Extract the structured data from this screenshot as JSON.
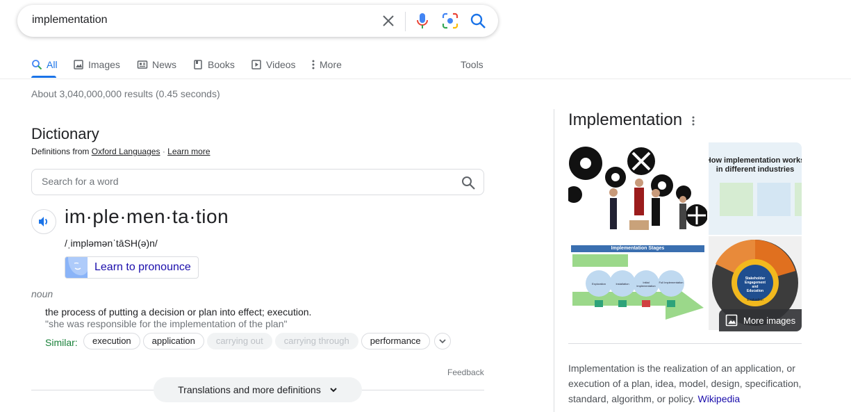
{
  "search": {
    "query": "implementation"
  },
  "tabs": [
    {
      "label": "All"
    },
    {
      "label": "Images"
    },
    {
      "label": "News"
    },
    {
      "label": "Books"
    },
    {
      "label": "Videos"
    },
    {
      "label": "More"
    }
  ],
  "tools_label": "Tools",
  "stats": "About 3,040,000,000 results (0.45 seconds)",
  "dictionary": {
    "title": "Dictionary",
    "source_prefix": "Definitions from",
    "source_name": "Oxford Languages",
    "separator": "·",
    "learn_more": "Learn more",
    "word_search_placeholder": "Search for a word",
    "headword": "im·ple·men·ta·tion",
    "phonetic": "/ˌimpləmənˈtāSH(ə)n/",
    "learn_pronounce": "Learn to pronounce",
    "part_of_speech": "noun",
    "definition": "the process of putting a decision or plan into effect; execution.",
    "example": "\"she was responsible for the implementation of the plan\"",
    "similar_label": "Similar:",
    "similar": [
      {
        "label": "execution",
        "muted": false
      },
      {
        "label": "application",
        "muted": false
      },
      {
        "label": "carrying out",
        "muted": true
      },
      {
        "label": "carrying through",
        "muted": true
      },
      {
        "label": "performance",
        "muted": false
      }
    ],
    "feedback": "Feedback",
    "more_definitions": "Translations and more definitions"
  },
  "knowledge_panel": {
    "title": "Implementation",
    "image_texts": {
      "industries_heading": "How implementation works in different industries",
      "stages_heading": "Implementation Stages",
      "stages": [
        "Exploration",
        "Installation",
        "Initial Implementation",
        "Full Implementation"
      ],
      "wheel_center": "Stakeholder Engagement and Education",
      "wheel_ring": "Evaluation"
    },
    "more_images": "More images",
    "description": "Implementation is the realization of an application, or execution of a plan, idea, model, design, specification, standard, algorithm, or policy.",
    "source_link": "Wikipedia"
  },
  "colors": {
    "accent": "#1a73e8",
    "link": "#1a0dab",
    "similar_green": "#188038"
  }
}
